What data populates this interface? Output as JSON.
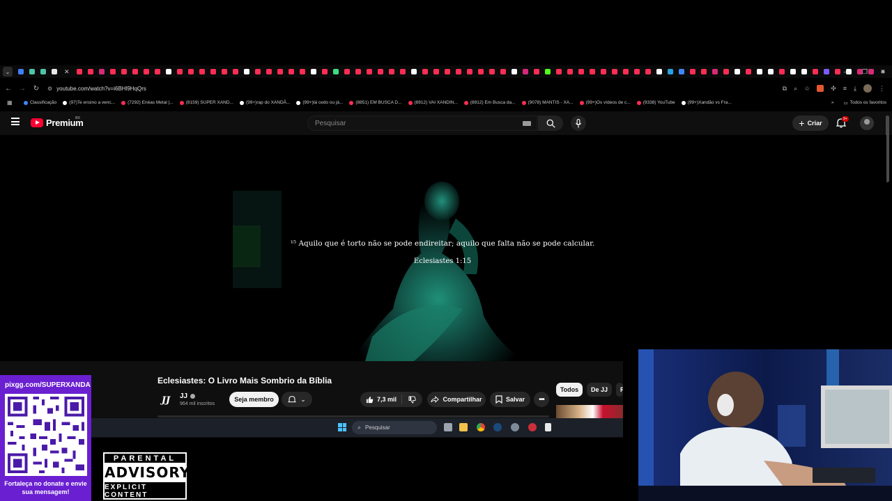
{
  "browser": {
    "url": "youtube.com/watch?v=i6BHl9HqQrs",
    "favicon_colors": [
      "#3d7ff5",
      "#4ec3a8",
      "#4ec3a8",
      "#e8e8e8",
      "#ff2d55",
      "#ff2d55",
      "#d62976",
      "#ff2d55",
      "#ff2d55",
      "#ff2d55",
      "#ff2d55",
      "#ff2d55",
      "#ffffff",
      "#ff2d55",
      "#ff2d55",
      "#ff2d55",
      "#ff2d55",
      "#ff2d55",
      "#ff2d55",
      "#ffffff",
      "#ff2d55",
      "#ff2d55",
      "#ff2d55",
      "#ff2d55",
      "#ff2d55",
      "#ffffff",
      "#ff2d55",
      "#3ddc84",
      "#ff2d55",
      "#ff2d55",
      "#ff2d55",
      "#ff2d55",
      "#ff2d55",
      "#ff2d55",
      "#ffffff",
      "#ff2d55",
      "#ff2d55",
      "#ff2d55",
      "#ff2d55",
      "#ff2d55",
      "#ff2d55",
      "#ff2d55",
      "#ff2d55",
      "#ffffff",
      "#d62976",
      "#ff2d55",
      "#53fc18",
      "#ff2d55",
      "#ff2d55",
      "#ff2d55",
      "#ff2d55",
      "#ff2d55",
      "#ff2d55",
      "#ff2d55",
      "#ff2d55",
      "#ff2d55",
      "#ffffff",
      "#2aa1e0",
      "#4285f4",
      "#ff2d55",
      "#ff2d55",
      "#d62976",
      "#ff2d55",
      "#ffffff",
      "#ff2d55",
      "#ffffff",
      "#ffffff",
      "#ff2d55",
      "#ffffff",
      "#ffffff",
      "#ff2d55",
      "#7b5cff",
      "#ff2d55",
      "#ffffff",
      "#d62976",
      "#d62976"
    ],
    "bookmarks": [
      {
        "label": "Classificação",
        "color": "#4285f4"
      },
      {
        "label": "(97)Te ensino a venc...",
        "color": "#ffffff"
      },
      {
        "label": "(7292) Enéas Metal |...",
        "color": "#ff2d55"
      },
      {
        "label": "(8159) SUPER XAND...",
        "color": "#ff2d55"
      },
      {
        "label": "(99+)rap do XANDÃ...",
        "color": "#ffffff"
      },
      {
        "label": "(99+)tá cedo ou já...",
        "color": "#ffffff"
      },
      {
        "label": "(8851) EM BUSCA D...",
        "color": "#ff2d55"
      },
      {
        "label": "(8912) VAI XANDIN...",
        "color": "#ff2d55"
      },
      {
        "label": "(8912) Em Busca da...",
        "color": "#ff2d55"
      },
      {
        "label": "(9078) MANTIS - XA...",
        "color": "#ff2d55"
      },
      {
        "label": "(99+)Os vídeos de c...",
        "color": "#ff2d55"
      },
      {
        "label": "(9338) YouTube",
        "color": "#ff2d55"
      },
      {
        "label": "(99+)Xandão vs Fra...",
        "color": "#ffffff"
      }
    ],
    "all_bookmarks_label": "Todos os favoritos"
  },
  "youtube": {
    "logo_text": "Premium",
    "region": "BR",
    "search_placeholder": "Pesquisar",
    "create_label": "Criar",
    "notifications_badge": "9+"
  },
  "video": {
    "verse": "¹⁵ Aquilo que é torto não se pode endireitar; aquilo que falta não se pode calcular.",
    "reference": "Eclesiastes 1:15",
    "title": "Eclesiastes: O Livro Mais Sombrio da Bíblia",
    "channel_initials": "JJ",
    "channel_name": "JJ",
    "subscribers": "964 mil inscritos",
    "member_label": "Seja membro",
    "likes": "7,3 mil",
    "share_label": "Compartilhar",
    "save_label": "Salvar",
    "chips": [
      "Todos",
      "De JJ",
      "R"
    ]
  },
  "taskbar": {
    "search_placeholder": "Pesquisar"
  },
  "overlay": {
    "pix_url": "pixgg.com/SUPERXANDA",
    "pix_message": "Fortaleça no donate e envie sua mensagem!",
    "advisory_top": "PARENTAL",
    "advisory_mid": "ADVISORY",
    "advisory_bottom": "EXPLICIT CONTENT"
  }
}
